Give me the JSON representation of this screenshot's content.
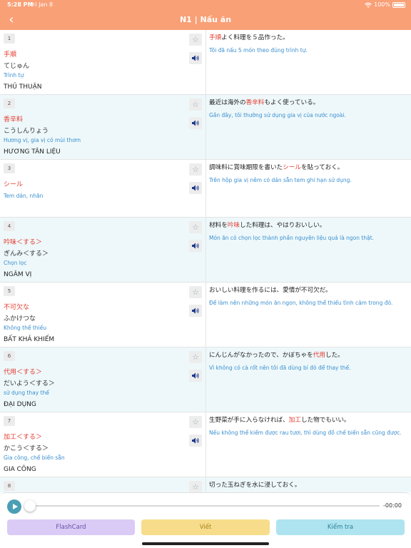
{
  "status": {
    "time": "5:28 PM",
    "date": "Fri Jan 8",
    "battery": "100%"
  },
  "nav": {
    "title": "N1 | Nấu ăn",
    "back_icon": "chevron-left-icon"
  },
  "items": [
    {
      "num": "1",
      "word": "手順",
      "reading": "てじゅん",
      "meaning": "Trình tự",
      "hanviet": "THỦ THUẬN",
      "sentence": [
        {
          "t": "手順",
          "hl": true
        },
        {
          "t": "よく料理を５品作った。",
          "hl": false
        }
      ],
      "translation": "Tôi đã nấu 5 món theo đúng trình tự."
    },
    {
      "num": "2",
      "word": "香辛料",
      "reading": "こうしんりょう",
      "meaning": "Hương vị, gia vị có mùi thơm",
      "hanviet": "HƯƠNG TÂN LIỆU",
      "sentence": [
        {
          "t": "最近は海外の",
          "hl": false
        },
        {
          "t": "香辛料",
          "hl": true
        },
        {
          "t": "もよく使っている。",
          "hl": false
        }
      ],
      "translation": "Gần đây, tôi thường sử dụng gia vị của nước ngoài."
    },
    {
      "num": "3",
      "word": "シール",
      "reading": "",
      "meaning": "Tem dán, nhãn",
      "hanviet": "",
      "sentence": [
        {
          "t": "調味料に賞味期限を書いた",
          "hl": false
        },
        {
          "t": "シール",
          "hl": true
        },
        {
          "t": "を貼っておく。",
          "hl": false
        }
      ],
      "translation": "Trên hộp gia vị nêm có dán sẵn tem ghi hạn sử dụng."
    },
    {
      "num": "4",
      "word": "吟味＜する＞",
      "reading": "ぎんみ＜する＞",
      "meaning": "Chọn lọc",
      "hanviet": "NGÂM VỊ",
      "sentence": [
        {
          "t": "材料を",
          "hl": false
        },
        {
          "t": "吟味",
          "hl": true
        },
        {
          "t": "した料理は、やはりおいしい。",
          "hl": false
        }
      ],
      "translation": "Món ăn có chọn lọc thành phần nguyên liệu quả là ngon thật."
    },
    {
      "num": "5",
      "word": "不可欠な",
      "reading": "ふかけつな",
      "meaning": "Không thể thiếu",
      "hanviet": "BẤT KHẢ KHIẾM",
      "sentence": [
        {
          "t": "おいしい料理を作るには、愛情が不可欠だ。",
          "hl": false
        }
      ],
      "translation": "Để làm nên những món ăn ngon, không thể thiếu tình cảm trong đó."
    },
    {
      "num": "6",
      "word": "代用＜する＞",
      "reading": "だいよう＜する＞",
      "meaning": "sử dụng thay thế",
      "hanviet": "ĐẠI DỤNG",
      "sentence": [
        {
          "t": "にんじんがなかったので、かぼちゃを",
          "hl": false
        },
        {
          "t": "代用",
          "hl": true
        },
        {
          "t": "した。",
          "hl": false
        }
      ],
      "translation": "Vì không có cà rốt nên tôi đã dùng bí đỏ để thay thế."
    },
    {
      "num": "7",
      "word": "加工＜する＞",
      "reading": "かこう＜する＞",
      "meaning": "Gia công, chế biến sẵn",
      "hanviet": "GIA CÔNG",
      "sentence": [
        {
          "t": "生野菜が手に入らなければ、",
          "hl": false
        },
        {
          "t": "加工",
          "hl": true
        },
        {
          "t": "した物でもいい。",
          "hl": false
        }
      ],
      "translation": "Nếu không thể kiếm được rau tươi, thì dùng đồ chế biến sẵn cũng được."
    },
    {
      "num": "8",
      "word": "",
      "reading": "",
      "meaning": "",
      "hanviet": "",
      "sentence": [
        {
          "t": "切った玉ねぎを水に浸しておく。",
          "hl": false
        }
      ],
      "translation": ""
    }
  ],
  "player": {
    "time_label": "-00:00",
    "progress": 0,
    "flashcard_label": "FlashCard",
    "write_label": "Viết",
    "test_label": "Kiểm tra"
  },
  "icons": {
    "star": "star-icon",
    "speaker": "speaker-icon",
    "play": "play-icon"
  },
  "colors": {
    "header": "#f9a077",
    "highlight": "#e43a2f",
    "meaning": "#3a8fd0",
    "row_alt": "#eef8fa"
  }
}
